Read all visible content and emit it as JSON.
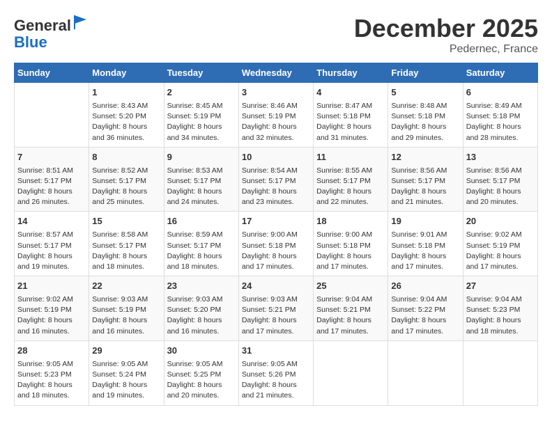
{
  "header": {
    "logo_general": "General",
    "logo_blue": "Blue",
    "month_title": "December 2025",
    "location": "Pedernec, France"
  },
  "days_of_week": [
    "Sunday",
    "Monday",
    "Tuesday",
    "Wednesday",
    "Thursday",
    "Friday",
    "Saturday"
  ],
  "weeks": [
    [
      {
        "day": "",
        "info": ""
      },
      {
        "day": "1",
        "info": "Sunrise: 8:43 AM\nSunset: 5:20 PM\nDaylight: 8 hours\nand 36 minutes."
      },
      {
        "day": "2",
        "info": "Sunrise: 8:45 AM\nSunset: 5:19 PM\nDaylight: 8 hours\nand 34 minutes."
      },
      {
        "day": "3",
        "info": "Sunrise: 8:46 AM\nSunset: 5:19 PM\nDaylight: 8 hours\nand 32 minutes."
      },
      {
        "day": "4",
        "info": "Sunrise: 8:47 AM\nSunset: 5:18 PM\nDaylight: 8 hours\nand 31 minutes."
      },
      {
        "day": "5",
        "info": "Sunrise: 8:48 AM\nSunset: 5:18 PM\nDaylight: 8 hours\nand 29 minutes."
      },
      {
        "day": "6",
        "info": "Sunrise: 8:49 AM\nSunset: 5:18 PM\nDaylight: 8 hours\nand 28 minutes."
      }
    ],
    [
      {
        "day": "7",
        "info": "Sunrise: 8:51 AM\nSunset: 5:17 PM\nDaylight: 8 hours\nand 26 minutes."
      },
      {
        "day": "8",
        "info": "Sunrise: 8:52 AM\nSunset: 5:17 PM\nDaylight: 8 hours\nand 25 minutes."
      },
      {
        "day": "9",
        "info": "Sunrise: 8:53 AM\nSunset: 5:17 PM\nDaylight: 8 hours\nand 24 minutes."
      },
      {
        "day": "10",
        "info": "Sunrise: 8:54 AM\nSunset: 5:17 PM\nDaylight: 8 hours\nand 23 minutes."
      },
      {
        "day": "11",
        "info": "Sunrise: 8:55 AM\nSunset: 5:17 PM\nDaylight: 8 hours\nand 22 minutes."
      },
      {
        "day": "12",
        "info": "Sunrise: 8:56 AM\nSunset: 5:17 PM\nDaylight: 8 hours\nand 21 minutes."
      },
      {
        "day": "13",
        "info": "Sunrise: 8:56 AM\nSunset: 5:17 PM\nDaylight: 8 hours\nand 20 minutes."
      }
    ],
    [
      {
        "day": "14",
        "info": "Sunrise: 8:57 AM\nSunset: 5:17 PM\nDaylight: 8 hours\nand 19 minutes."
      },
      {
        "day": "15",
        "info": "Sunrise: 8:58 AM\nSunset: 5:17 PM\nDaylight: 8 hours\nand 18 minutes."
      },
      {
        "day": "16",
        "info": "Sunrise: 8:59 AM\nSunset: 5:17 PM\nDaylight: 8 hours\nand 18 minutes."
      },
      {
        "day": "17",
        "info": "Sunrise: 9:00 AM\nSunset: 5:18 PM\nDaylight: 8 hours\nand 17 minutes."
      },
      {
        "day": "18",
        "info": "Sunrise: 9:00 AM\nSunset: 5:18 PM\nDaylight: 8 hours\nand 17 minutes."
      },
      {
        "day": "19",
        "info": "Sunrise: 9:01 AM\nSunset: 5:18 PM\nDaylight: 8 hours\nand 17 minutes."
      },
      {
        "day": "20",
        "info": "Sunrise: 9:02 AM\nSunset: 5:19 PM\nDaylight: 8 hours\nand 17 minutes."
      }
    ],
    [
      {
        "day": "21",
        "info": "Sunrise: 9:02 AM\nSunset: 5:19 PM\nDaylight: 8 hours\nand 16 minutes."
      },
      {
        "day": "22",
        "info": "Sunrise: 9:03 AM\nSunset: 5:19 PM\nDaylight: 8 hours\nand 16 minutes."
      },
      {
        "day": "23",
        "info": "Sunrise: 9:03 AM\nSunset: 5:20 PM\nDaylight: 8 hours\nand 16 minutes."
      },
      {
        "day": "24",
        "info": "Sunrise: 9:03 AM\nSunset: 5:21 PM\nDaylight: 8 hours\nand 17 minutes."
      },
      {
        "day": "25",
        "info": "Sunrise: 9:04 AM\nSunset: 5:21 PM\nDaylight: 8 hours\nand 17 minutes."
      },
      {
        "day": "26",
        "info": "Sunrise: 9:04 AM\nSunset: 5:22 PM\nDaylight: 8 hours\nand 17 minutes."
      },
      {
        "day": "27",
        "info": "Sunrise: 9:04 AM\nSunset: 5:23 PM\nDaylight: 8 hours\nand 18 minutes."
      }
    ],
    [
      {
        "day": "28",
        "info": "Sunrise: 9:05 AM\nSunset: 5:23 PM\nDaylight: 8 hours\nand 18 minutes."
      },
      {
        "day": "29",
        "info": "Sunrise: 9:05 AM\nSunset: 5:24 PM\nDaylight: 8 hours\nand 19 minutes."
      },
      {
        "day": "30",
        "info": "Sunrise: 9:05 AM\nSunset: 5:25 PM\nDaylight: 8 hours\nand 20 minutes."
      },
      {
        "day": "31",
        "info": "Sunrise: 9:05 AM\nSunset: 5:26 PM\nDaylight: 8 hours\nand 21 minutes."
      },
      {
        "day": "",
        "info": ""
      },
      {
        "day": "",
        "info": ""
      },
      {
        "day": "",
        "info": ""
      }
    ]
  ]
}
